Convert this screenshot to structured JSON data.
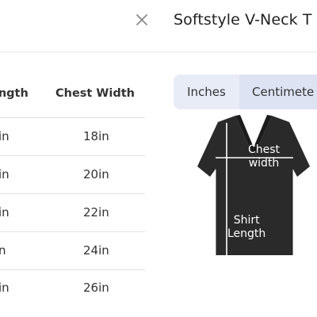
{
  "header": {
    "title": "Softstyle V-Neck T",
    "close_icon": "close-icon"
  },
  "size_table": {
    "columns": [
      "ength",
      "Chest Width"
    ],
    "rows": [
      {
        "length": "in",
        "chest": "18in"
      },
      {
        "length": "in",
        "chest": "20in"
      },
      {
        "length": "in",
        "chest": "22in"
      },
      {
        "length": "n",
        "chest": "24in"
      },
      {
        "length": "in",
        "chest": "26in"
      }
    ]
  },
  "units": {
    "options": [
      "Inches",
      "Centimete"
    ],
    "selected": "Centimete"
  },
  "diagram": {
    "chest_label_1": "Chest",
    "chest_label_2": "width",
    "length_label_1": "Shirt",
    "length_label_2": "Length",
    "shirt_color": "#2a2a2a"
  },
  "colors": {
    "toggle_bg": "#e8ecf6",
    "toggle_selected": "#dde3f2",
    "divider": "#e3e3e3"
  }
}
